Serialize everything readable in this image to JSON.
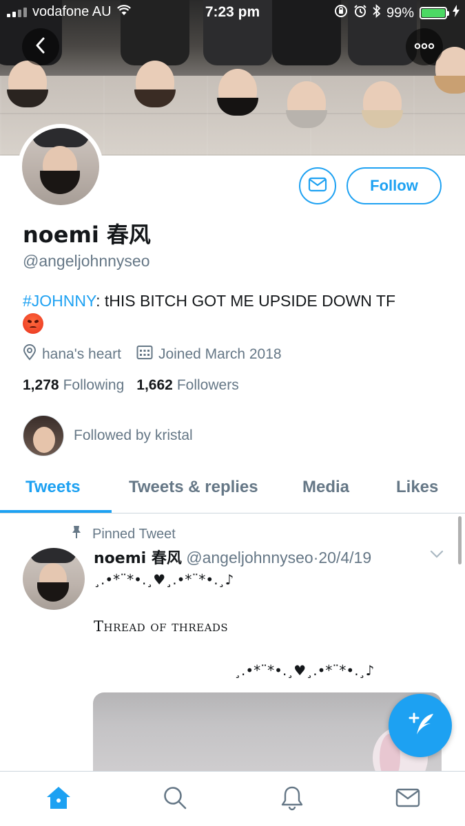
{
  "status_bar": {
    "carrier": "vodafone AU",
    "time": "7:23 pm",
    "battery": "99%",
    "battery_color": "#4cd964"
  },
  "header": {
    "back_icon": "chevron-left-icon",
    "more_icon": "ellipsis-icon"
  },
  "profile": {
    "name": "noemi 春风",
    "handle": "@angeljohnnyseo",
    "bio_hashtag": "#JOHNNY",
    "bio_text": ": tHIS BITCH GOT ME UPSIDE DOWN TF",
    "bio_emoji": "angry-face-emoji",
    "location": "hana's heart",
    "joined": "Joined March 2018",
    "following_count": "1,278",
    "following_label": "Following",
    "followers_count": "1,662",
    "followers_label": "Followers",
    "followed_by": "Followed by kristal"
  },
  "actions": {
    "message_icon": "envelope-icon",
    "follow_label": "Follow"
  },
  "tabs": [
    {
      "label": "Tweets",
      "active": true
    },
    {
      "label": "Tweets & replies",
      "active": false
    },
    {
      "label": "Media",
      "active": false
    },
    {
      "label": "Likes",
      "active": false
    }
  ],
  "pinned_tweet": {
    "pinned_label": "Pinned Tweet",
    "name": "noemi 春风",
    "handle": "@angeljohnnyseo",
    "separator": "·",
    "date": "20/4/19",
    "line1": "¸.•*¨*•.¸♥︎¸.•*¨*•.¸♪",
    "line2": "Thread of threads",
    "line3": "¸.•*¨*•.¸♥︎¸.•*¨*•.¸♪"
  },
  "fab": {
    "icon": "compose-tweet-icon"
  },
  "bottom_nav": [
    {
      "icon": "home-icon",
      "active": true
    },
    {
      "icon": "search-icon",
      "active": false
    },
    {
      "icon": "notifications-bell-icon",
      "active": false
    },
    {
      "icon": "messages-envelope-icon",
      "active": false
    }
  ],
  "colors": {
    "accent": "#1da1f2",
    "text": "#14171a",
    "secondary": "#657786",
    "border": "#ccd6dd"
  }
}
